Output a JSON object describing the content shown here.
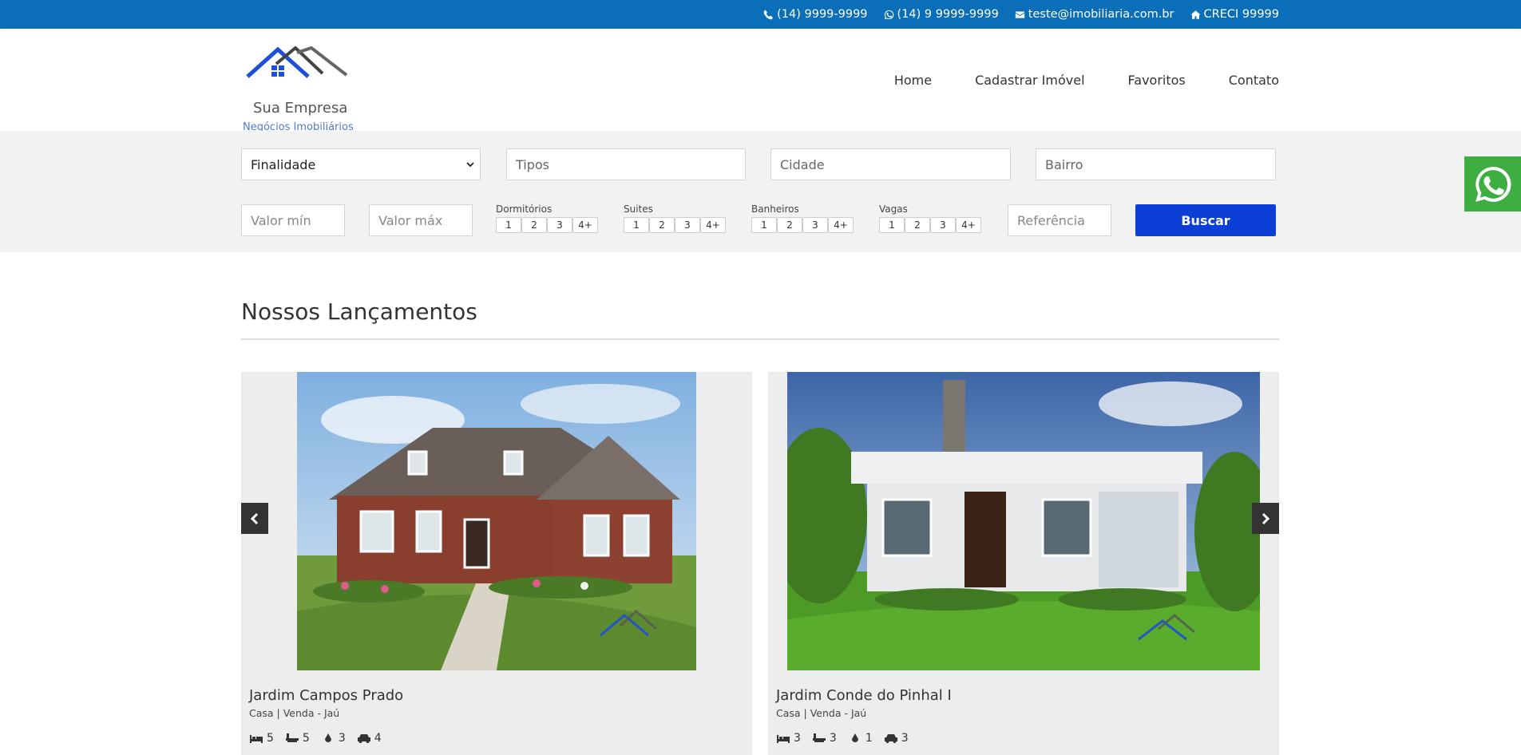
{
  "topbar": {
    "phone": "(14) 9999-9999",
    "whatsapp": "(14) 9 9999-9999",
    "email": "teste@imobiliaria.com.br",
    "creci": "CRECI 99999"
  },
  "brand": {
    "name": "Sua Empresa",
    "tagline": "Negócios Imobiliários"
  },
  "nav": [
    {
      "label": "Home"
    },
    {
      "label": "Cadastrar Imóvel"
    },
    {
      "label": "Favoritos"
    },
    {
      "label": "Contato"
    }
  ],
  "search": {
    "finalidade": "Finalidade",
    "tipos_placeholder": "Tipos",
    "cidade_placeholder": "Cidade",
    "bairro_placeholder": "Bairro",
    "valor_min_placeholder": "Valor mín",
    "valor_max_placeholder": "Valor máx",
    "referencia_placeholder": "Referência",
    "buscar_label": "Buscar",
    "filters": [
      {
        "label": "Dormitórios",
        "options": [
          "1",
          "2",
          "3",
          "4+"
        ]
      },
      {
        "label": "Suites",
        "options": [
          "1",
          "2",
          "3",
          "4+"
        ]
      },
      {
        "label": "Banheiros",
        "options": [
          "1",
          "2",
          "3",
          "4+"
        ]
      },
      {
        "label": "Vagas",
        "options": [
          "1",
          "2",
          "3",
          "4+"
        ]
      }
    ]
  },
  "section": {
    "title": "Nossos Lançamentos"
  },
  "listings": [
    {
      "title": "Jardim Campos Prado",
      "subtitle": "Casa | Venda - Jaú",
      "bedrooms": "5",
      "bathtubs": "5",
      "baths": "3",
      "garage": "4"
    },
    {
      "title": "Jardim Conde do Pinhal I",
      "subtitle": "Casa | Venda - Jaú",
      "bedrooms": "3",
      "bathtubs": "3",
      "baths": "1",
      "garage": "3"
    }
  ],
  "colors": {
    "topbar": "#0a6fb8",
    "buscar": "#0c3fd6",
    "whatsapp": "#3dae3f",
    "brand_blue": "#1d4fd8"
  }
}
